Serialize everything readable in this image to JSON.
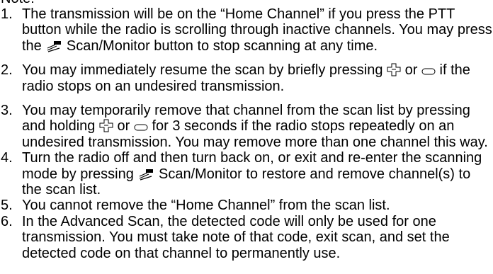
{
  "heading": "Note:",
  "notes": [
    {
      "number": "1.",
      "t1": "The transmission will be on the “Home Channel” if you press the PTT button while the radio is scrolling through inactive channels. You may press the ",
      "t2": " Scan/Monitor button to stop scanning at any time."
    },
    {
      "number": "2.",
      "t1": "You may immediately resume the scan by briefly pressing ",
      "t2": " or ",
      "t3": " if the radio stops on an undesired transmission."
    },
    {
      "number": "3.",
      "t1": "You may temporarily remove that channel from the scan list by pressing and holding ",
      "t2": " or ",
      "t3": " for 3 seconds if the radio stops repeatedly on an undesired transmission. You may remove more than one channel this way."
    },
    {
      "number": "4.",
      "t1": "Turn the radio off and then turn back on, or exit and re-enter the scanning mode by pressing ",
      "t2": " Scan/Monitor to restore and remove channel(s) to the scan list."
    },
    {
      "number": "5.",
      "t1": "You cannot remove the “Home Channel” from the scan list."
    },
    {
      "number": "6.",
      "t1": "In the Advanced Scan, the detected code will only be used for one transmission. You must take note of that code, exit scan, and set the detected code on that channel to permanently use."
    }
  ],
  "icons": {
    "scan_monitor": "scan-monitor-icon",
    "navigation": "navigation-cross-icon",
    "back": "back-key-icon"
  }
}
